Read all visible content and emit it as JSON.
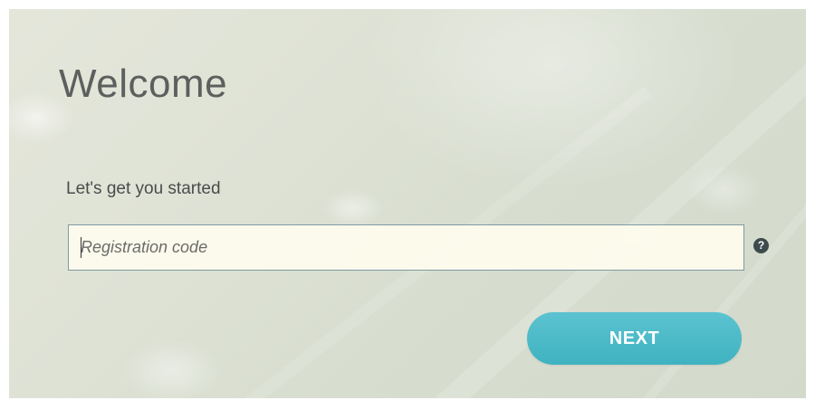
{
  "page": {
    "title": "Welcome",
    "subtitle": "Let's get you started"
  },
  "registration": {
    "placeholder": "Registration code",
    "value": "",
    "help_icon": "question-circle-icon",
    "help_glyph": "?"
  },
  "actions": {
    "next_label": "NEXT",
    "accent_color": "#4bb9c7"
  }
}
